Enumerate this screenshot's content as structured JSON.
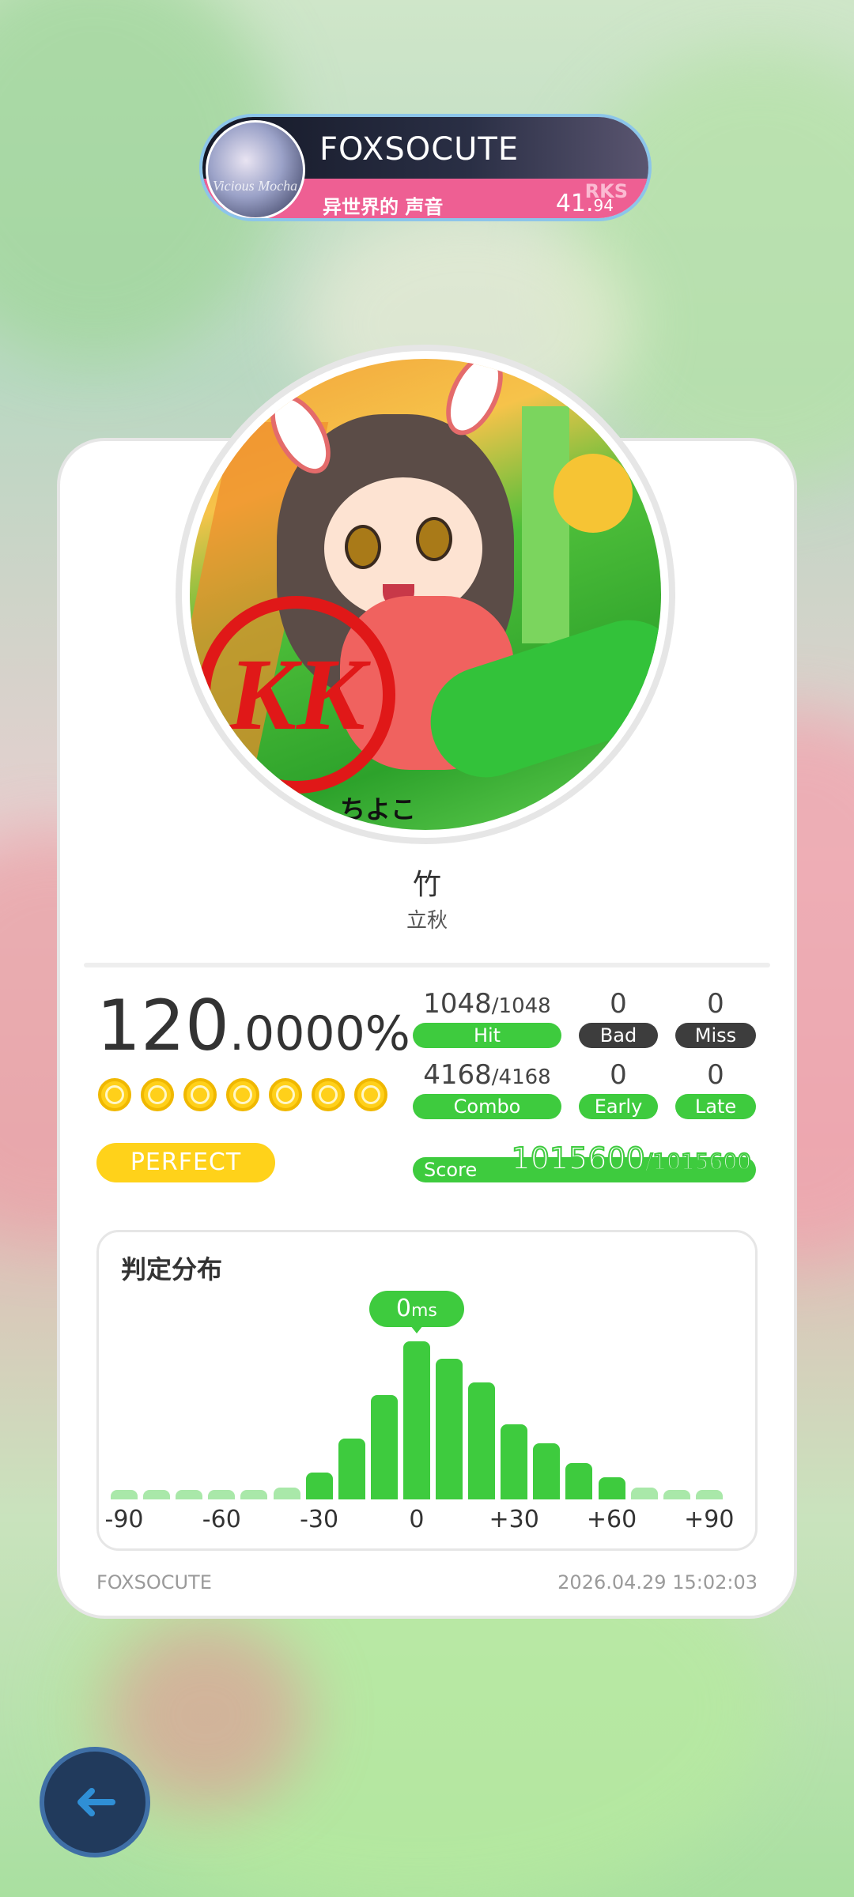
{
  "player": {
    "name": "FOXSOCUTE",
    "avatar_caption": "Vicious Mocha",
    "song": "异世界的 声音",
    "rks_label": "RKS",
    "rks_int": "41.",
    "rks_dec": "94"
  },
  "song": {
    "title": "竹",
    "artist": "立秋",
    "stamp_text": "KK",
    "signature": "ちよこ"
  },
  "accuracy": {
    "int": "120",
    "dec": ".0000%",
    "dots": 7,
    "grade": "PERFECT"
  },
  "stats": {
    "hit": {
      "value": "1048",
      "total": "/1048",
      "label": "Hit"
    },
    "bad": {
      "value": "0",
      "label": "Bad"
    },
    "miss": {
      "value": "0",
      "label": "Miss"
    },
    "combo": {
      "value": "4168",
      "total": "/4168",
      "label": "Combo"
    },
    "early": {
      "value": "0",
      "label": "Early"
    },
    "late": {
      "value": "0",
      "label": "Late"
    }
  },
  "score": {
    "label": "Score",
    "value": "1015600",
    "total": "/1015600"
  },
  "distribution": {
    "title": "判定分布",
    "tooltip_value": "0",
    "tooltip_unit": "ms"
  },
  "chart_data": {
    "type": "bar",
    "title": "判定分布",
    "x_ticks": [
      "-90",
      "-60",
      "-30",
      "0",
      "+30",
      "+60",
      "+90"
    ],
    "x_range": [
      -90,
      90
    ],
    "bin_width_ms": 10,
    "bins_ms": [
      -90,
      -80,
      -70,
      -60,
      -50,
      -40,
      -30,
      -20,
      -10,
      0,
      10,
      20,
      30,
      40,
      50,
      60,
      70,
      80,
      90
    ],
    "values": [
      8,
      8,
      8,
      8,
      8,
      10,
      22,
      50,
      86,
      130,
      116,
      96,
      62,
      46,
      30,
      18,
      10,
      8,
      8
    ],
    "highlight_bin": 0,
    "bar_color": "#3ecb3e",
    "faded_color": "#a9e8a9"
  },
  "footer": {
    "name": "FOXSOCUTE",
    "timestamp": "2026.04.29 15:02:03"
  },
  "back_button": {
    "icon": "arrow-left-icon"
  }
}
